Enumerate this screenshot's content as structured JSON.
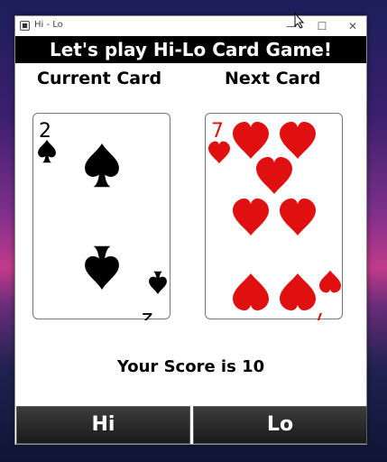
{
  "window": {
    "title": "Hi - Lo",
    "minimize": "—",
    "maximize": "☐",
    "close": "✕"
  },
  "banner": {
    "text": "Let's play Hi-Lo Card Game!"
  },
  "labels": {
    "current": "Current Card",
    "next": "Next Card"
  },
  "current_card": {
    "rank": "2",
    "suit": "spades",
    "color": "#000000"
  },
  "next_card": {
    "rank": "7",
    "suit": "hearts",
    "color": "#e01010"
  },
  "score": {
    "text": "Your Score is 10"
  },
  "buttons": {
    "hi": "Hi",
    "lo": "Lo"
  },
  "colors": {
    "banner_bg": "#000000",
    "button_bg": "#2b2b2b",
    "accent_red": "#e01010"
  }
}
